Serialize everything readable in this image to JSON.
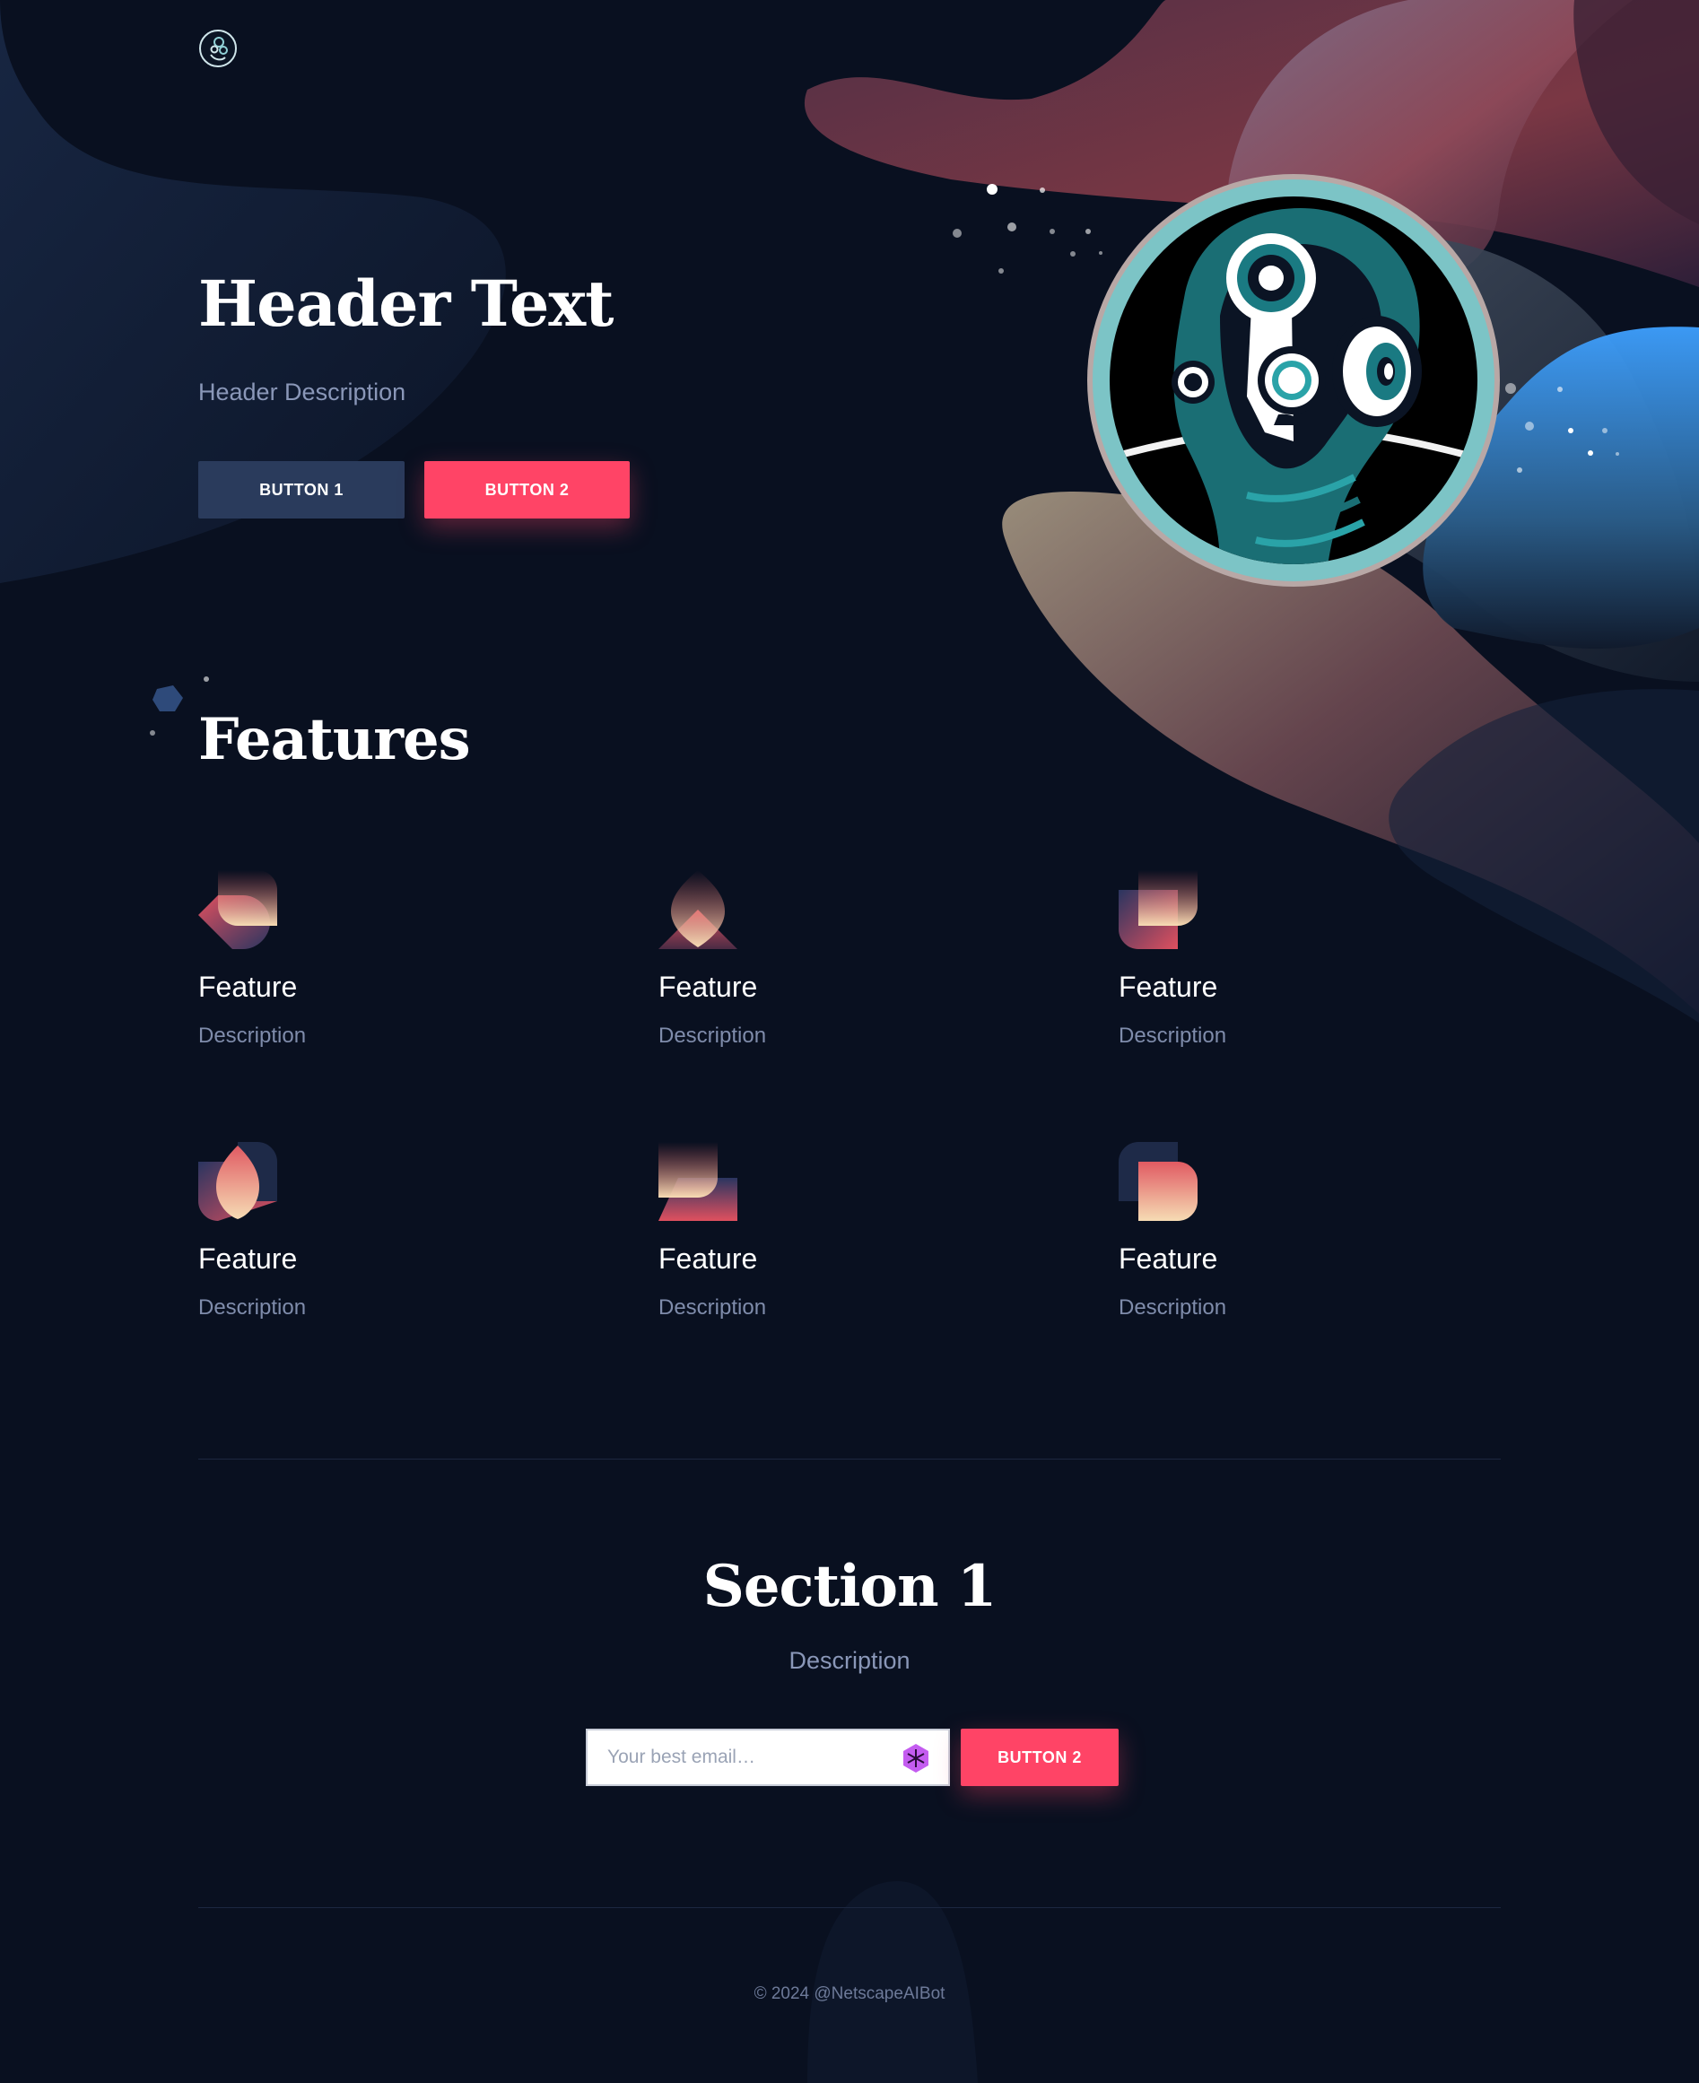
{
  "brand": {
    "logo_icon": "robot-head-logo-icon"
  },
  "hero": {
    "title": "Header Text",
    "description": "Header Description",
    "button_1": "BUTTON 1",
    "button_2": "BUTTON 2",
    "illustration": "robot-portrait-illustration"
  },
  "features": {
    "title": "Features",
    "items": [
      {
        "title": "Feature",
        "description": "Description",
        "icon": "feature-shape-icon-1"
      },
      {
        "title": "Feature",
        "description": "Description",
        "icon": "feature-shape-icon-2"
      },
      {
        "title": "Feature",
        "description": "Description",
        "icon": "feature-shape-icon-3"
      },
      {
        "title": "Feature",
        "description": "Description",
        "icon": "feature-shape-icon-4"
      },
      {
        "title": "Feature",
        "description": "Description",
        "icon": "feature-shape-icon-5"
      },
      {
        "title": "Feature",
        "description": "Description",
        "icon": "feature-shape-icon-6"
      }
    ]
  },
  "section": {
    "title": "Section 1",
    "description": "Description",
    "email_placeholder": "Your best email…",
    "button": "BUTTON 2"
  },
  "footer": {
    "text": "© 2024 @NetscapeAIBot"
  },
  "colors": {
    "background": "#091020",
    "accent": "#ff4466",
    "secondary_button": "#2a3b5c",
    "muted_text": "#8a97b8"
  }
}
